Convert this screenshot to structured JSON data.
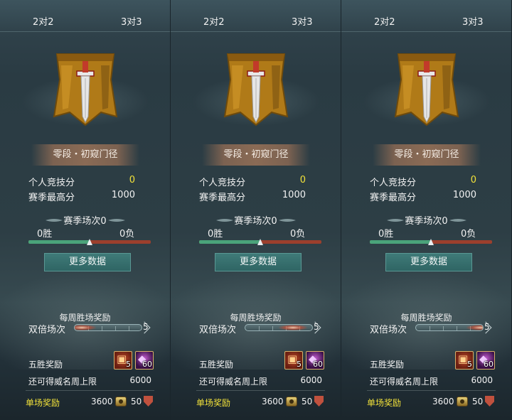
{
  "panels": [
    {
      "tabs": {
        "left": "2对2",
        "right": "3对3"
      },
      "rank_name": "零段・初窥门径",
      "stats": {
        "personal_score_label": "个人竞技分",
        "personal_score": "0",
        "season_best_label": "赛季最高分",
        "season_best": "1000"
      },
      "season_matches": "赛季场次0",
      "wins": "0胜",
      "losses": "0负",
      "win_ratio": 0.5,
      "more_data": "更多数据",
      "weekly_title": "每周胜场奖励",
      "double_label": "双倍场次",
      "double_count": "5",
      "double_glow": 0.1,
      "five_win_label": "五胜奖励",
      "five_win_items": [
        {
          "icon": "gift-box-icon",
          "count": "5"
        },
        {
          "icon": "crystal-icon",
          "count": "60"
        }
      ],
      "limit_label": "还可得威名周上限",
      "limit_value": "6000",
      "single_label": "单场奖励",
      "single_a": "3600",
      "single_b": "50"
    },
    {
      "tabs": {
        "left": "2对2",
        "right": "3对3"
      },
      "rank_name": "零段・初窥门径",
      "stats": {
        "personal_score_label": "个人竞技分",
        "personal_score": "0",
        "season_best_label": "赛季最高分",
        "season_best": "1000"
      },
      "season_matches": "赛季场次0",
      "wins": "0胜",
      "losses": "0负",
      "win_ratio": 0.5,
      "more_data": "更多数据",
      "weekly_title": "每周胜场奖励",
      "double_label": "双倍场次",
      "double_count": "5",
      "double_glow": 0.7,
      "five_win_label": "五胜奖励",
      "five_win_items": [
        {
          "icon": "gift-box-icon",
          "count": "5"
        },
        {
          "icon": "crystal-icon",
          "count": "60"
        }
      ],
      "limit_label": "还可得威名周上限",
      "limit_value": "6000",
      "single_label": "单场奖励",
      "single_a": "3600",
      "single_b": "50"
    },
    {
      "tabs": {
        "left": "2对2",
        "right": "3对3"
      },
      "rank_name": "零段・初窥门径",
      "stats": {
        "personal_score_label": "个人竞技分",
        "personal_score": "0",
        "season_best_label": "赛季最高分",
        "season_best": "1000"
      },
      "season_matches": "赛季场次0",
      "wins": "0胜",
      "losses": "0负",
      "win_ratio": 0.5,
      "more_data": "更多数据",
      "weekly_title": "每周胜场奖励",
      "double_label": "双倍场次",
      "double_count": "5",
      "double_glow": 0.95,
      "five_win_label": "五胜奖励",
      "five_win_items": [
        {
          "icon": "gift-box-icon",
          "count": "5"
        },
        {
          "icon": "crystal-icon",
          "count": "60"
        }
      ],
      "limit_label": "还可得威名周上限",
      "limit_value": "6000",
      "single_label": "单场奖励",
      "single_a": "3600",
      "single_b": "50"
    }
  ],
  "colors": {
    "accent_yellow": "#f2e23a",
    "win_green": "#4aa37a",
    "loss_red": "#9b3f2d",
    "button_teal": "#2f6564"
  }
}
